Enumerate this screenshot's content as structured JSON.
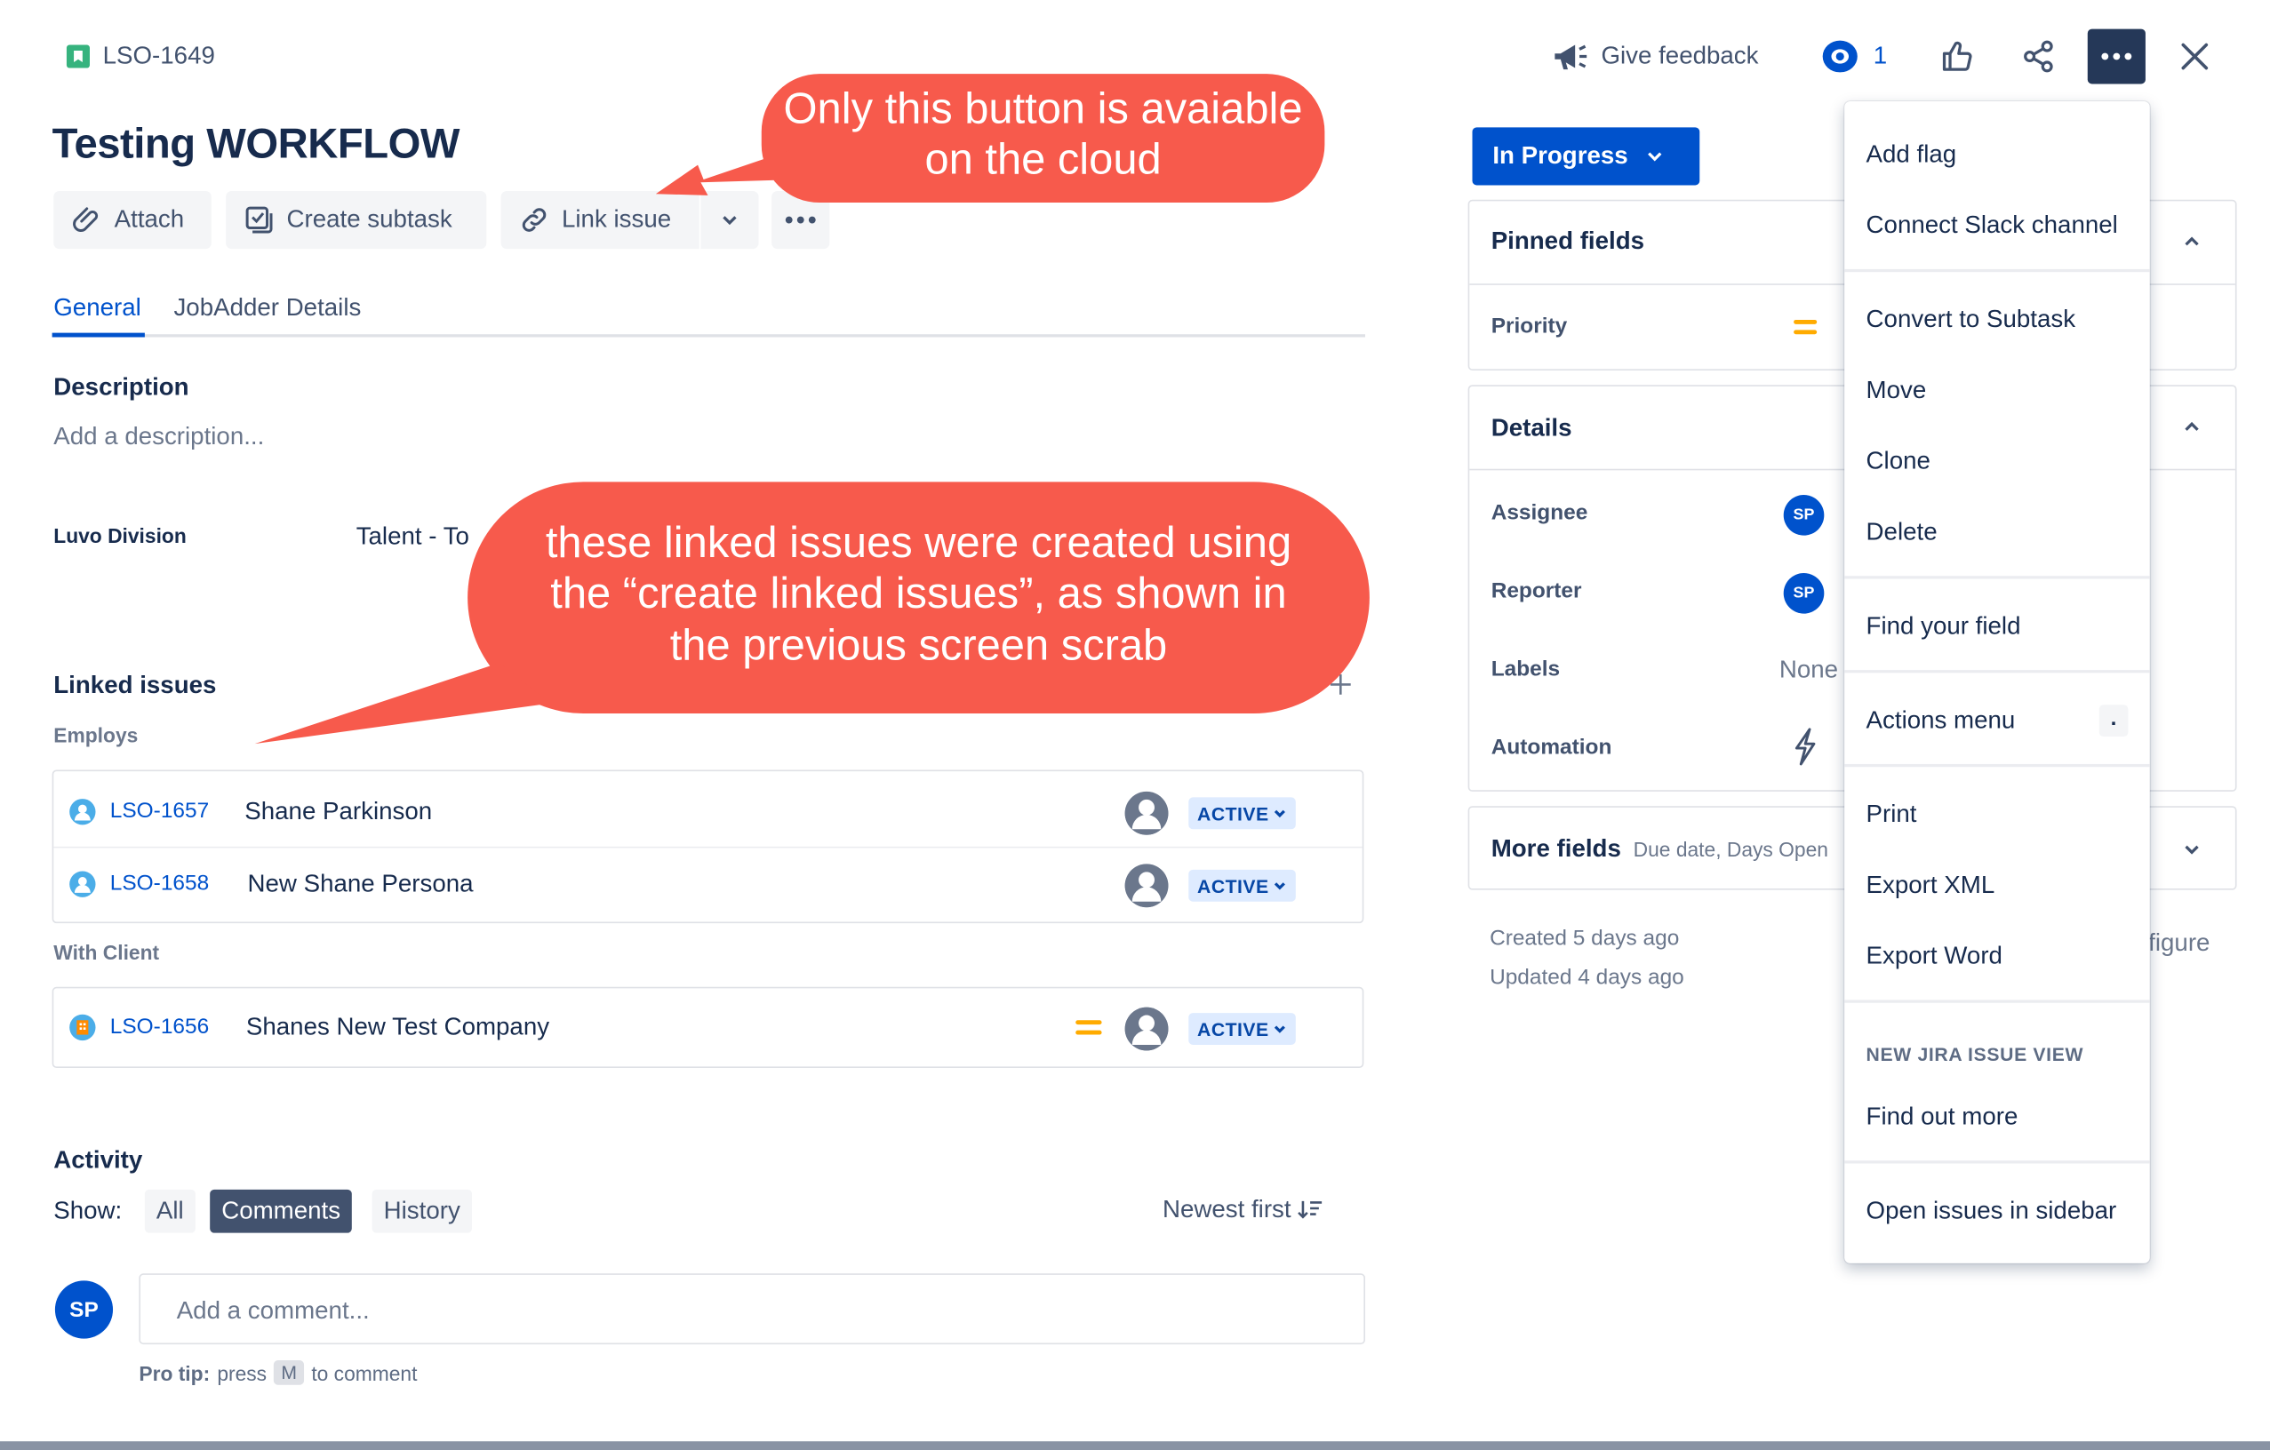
{
  "issue": {
    "key": "LSO-1649",
    "title": "Testing WORKFLOW"
  },
  "header": {
    "give_feedback": "Give feedback",
    "watch_count": "1"
  },
  "toolbar": {
    "attach": "Attach",
    "create_subtask": "Create subtask",
    "link_issue": "Link issue"
  },
  "tabs": [
    {
      "label": "General",
      "active": true
    },
    {
      "label": "JobAdder Details",
      "active": false
    }
  ],
  "description": {
    "heading": "Description",
    "placeholder": "Add a description..."
  },
  "luvo_division": {
    "label": "Luvo Division",
    "value": "Talent - To"
  },
  "linked_issues": {
    "heading": "Linked issues",
    "groups": [
      {
        "label": "Employs",
        "items": [
          {
            "key": "LSO-1657",
            "summary": "Shane Parkinson",
            "status": "ACTIVE"
          },
          {
            "key": "LSO-1658",
            "summary": "New Shane Persona",
            "status": "ACTIVE"
          }
        ]
      },
      {
        "label": "With Client",
        "items": [
          {
            "key": "LSO-1656",
            "summary": "Shanes New Test Company",
            "status": "ACTIVE"
          }
        ]
      }
    ]
  },
  "activity": {
    "heading": "Activity",
    "show_label": "Show:",
    "filters": [
      "All",
      "Comments",
      "History"
    ],
    "selected_filter": "Comments",
    "sort": "Newest first",
    "comment_placeholder": "Add a comment...",
    "user_initials": "SP",
    "pro_tip_bold": "Pro tip:",
    "pro_tip_press": "press",
    "pro_tip_key": "M",
    "pro_tip_rest": "to comment"
  },
  "status_button": "In Progress",
  "sidebar": {
    "pinned_fields": "Pinned fields",
    "priority_label": "Priority",
    "details": "Details",
    "assignee_label": "Assignee",
    "assignee_initials": "SP",
    "reporter_label": "Reporter",
    "reporter_initials": "SP",
    "labels_label": "Labels",
    "labels_value": "None",
    "automation_label": "Automation",
    "more_fields": "More fields",
    "more_fields_hint": "Due date, Days Open",
    "created": "Created 5 days ago",
    "updated": "Updated 4 days ago",
    "configure_partial": "figure"
  },
  "menu": {
    "items_1": [
      "Add flag",
      "Connect Slack channel"
    ],
    "items_2": [
      "Convert to Subtask",
      "Move",
      "Clone",
      "Delete"
    ],
    "items_3": [
      "Find your field"
    ],
    "actions_menu": "Actions menu",
    "actions_shortcut": ".",
    "items_4": [
      "Print",
      "Export XML",
      "Export Word"
    ],
    "group_heading": "NEW JIRA ISSUE VIEW",
    "find_out_more": "Find out more",
    "open_in_sidebar": "Open issues in sidebar"
  },
  "callouts": {
    "top_line1": "Only this button is avaiable",
    "top_line2": "on the cloud",
    "mid_line1": "these linked issues were created using",
    "mid_line2": "the “create linked issues”, as shown in",
    "mid_line3": "the previous screen scrab"
  },
  "colors": {
    "primary": "#0052CC",
    "callout": "#F75A4C",
    "priority_medium": "#FFAB00",
    "text": "#172B4D"
  }
}
